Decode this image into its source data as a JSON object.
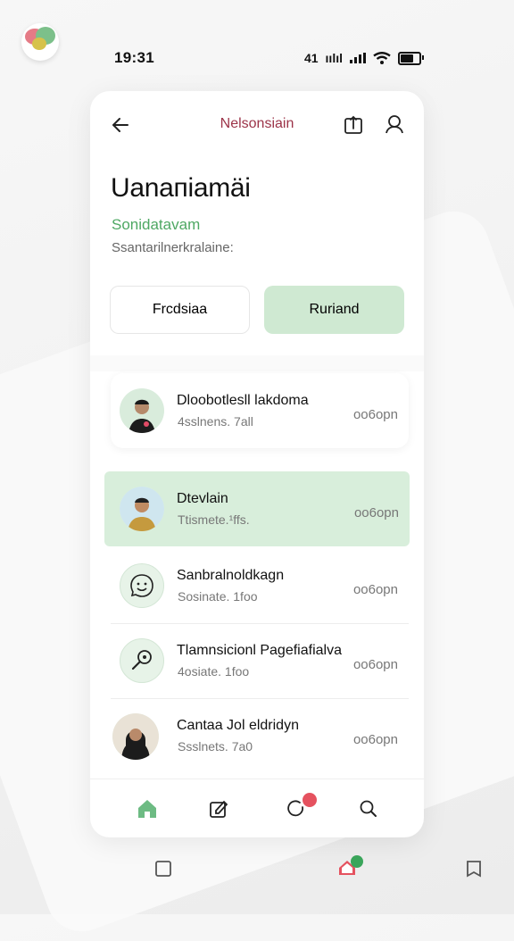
{
  "status_bar": {
    "time": "19:31",
    "carrier": "41",
    "signal": "ıılıl"
  },
  "nav": {
    "title": "Nelsonsiain"
  },
  "profile": {
    "heading": "Uanaпiamäi",
    "subtitle": "Sonidatavam",
    "caption": "Ssantarilnerkralaine:"
  },
  "actions": {
    "primary_label": "Frcdsiaa",
    "secondary_label": "Ruriand"
  },
  "contacts": [
    {
      "name": "Dloobotlesll lakdoma",
      "detail": "4sslnens. 7all",
      "time": "oo6opn"
    },
    {
      "name": "Dtevlain",
      "detail": "Ttismete.¹ffs.",
      "time": "oo6opn"
    },
    {
      "name": "Sanbralnoldkagn",
      "detail": "Sosinate. 1foo",
      "time": "oo6opn"
    },
    {
      "name": "Tlamnsicionl Pagefiafialva",
      "detail": "4osiate. 1foo",
      "time": "oo6opn"
    },
    {
      "name": "Cantaa Jol eldridyn",
      "detail": "Ssslnets. 7a0",
      "time": "oo6opn"
    }
  ],
  "colors": {
    "accent_green": "#4ea863",
    "accent_red": "#9c3348",
    "highlight": "#d8eedb",
    "badge": "#e5525f"
  }
}
